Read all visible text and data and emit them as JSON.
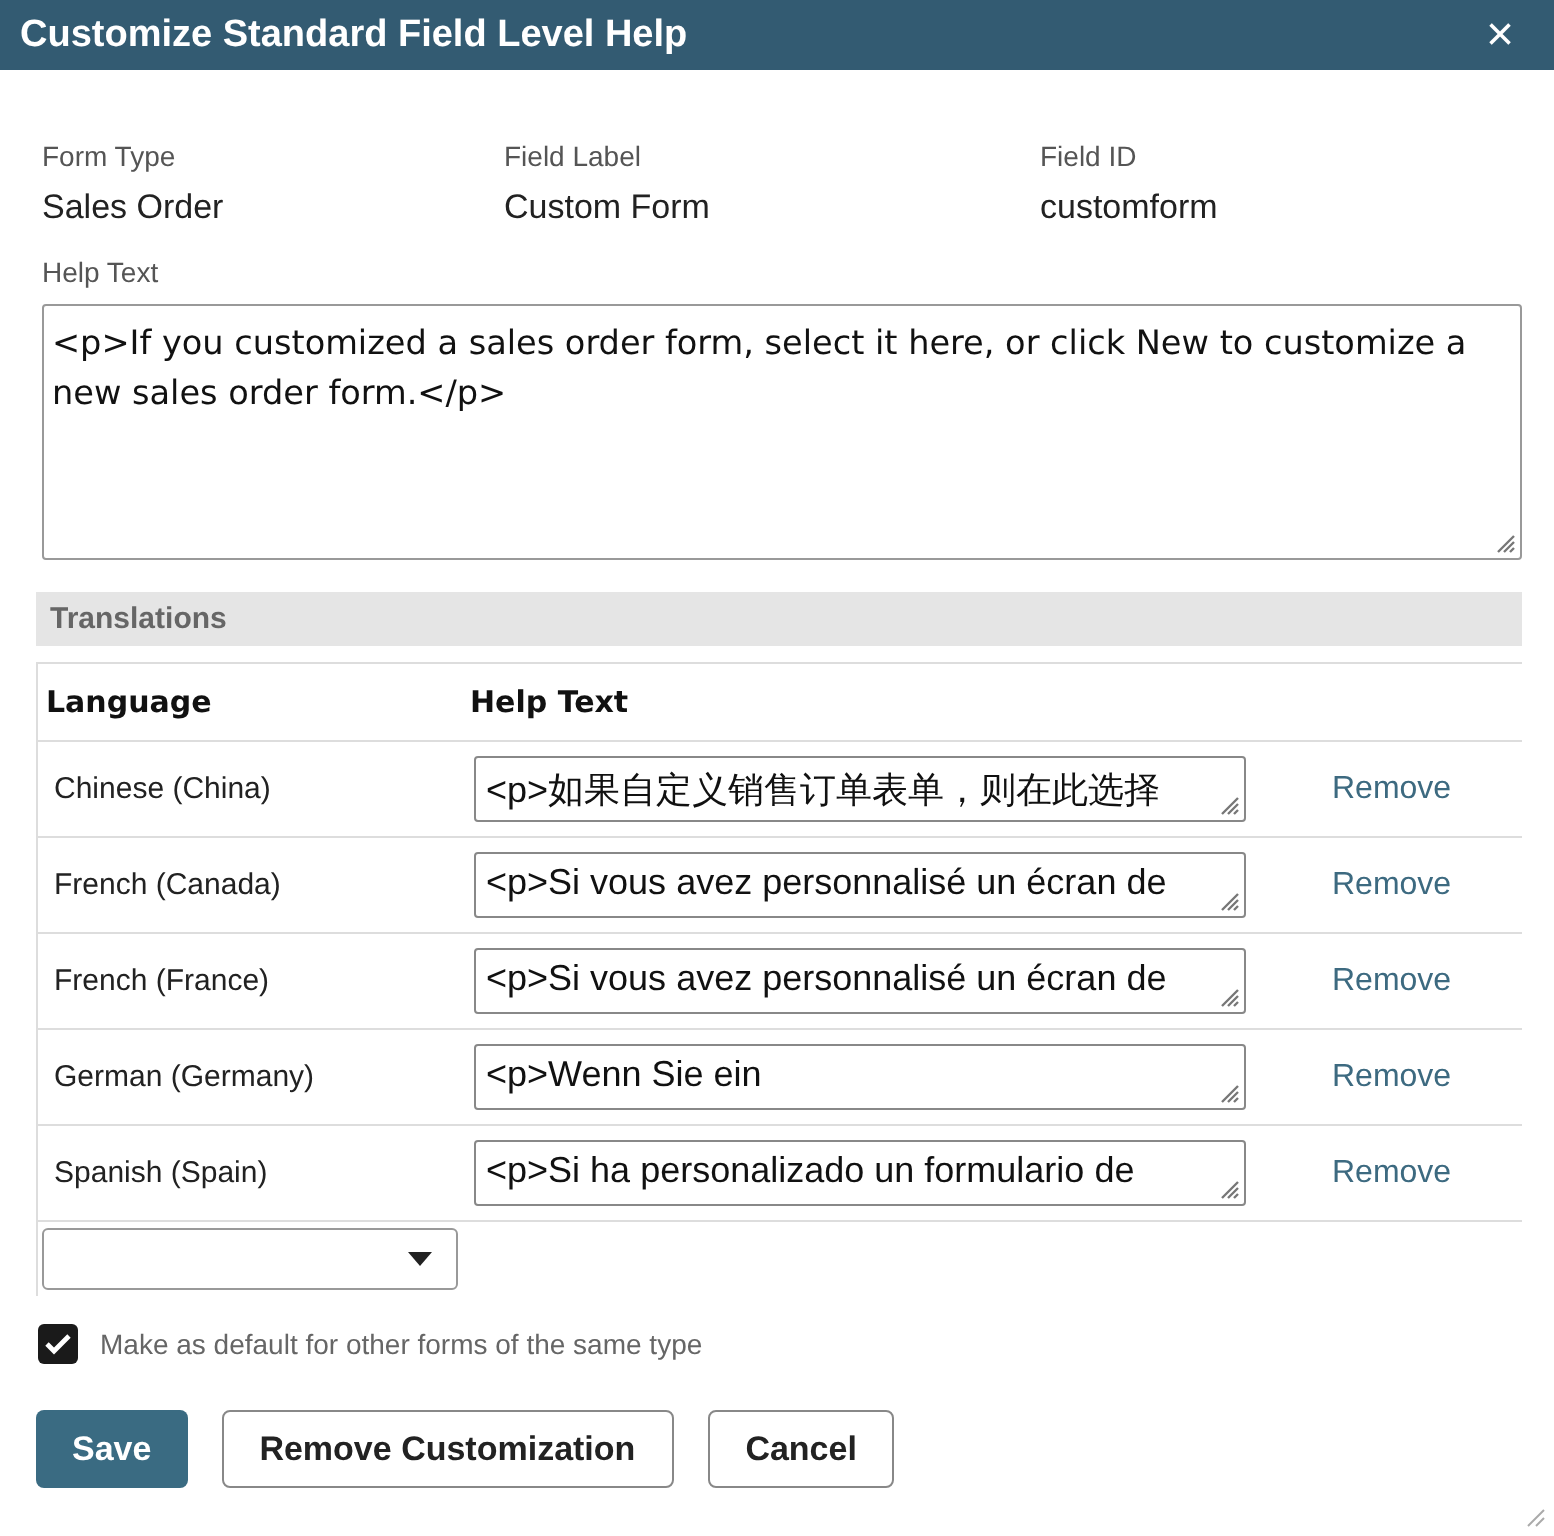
{
  "window": {
    "title": "Customize Standard Field Level Help",
    "close": "×"
  },
  "fields": [
    {
      "label": "Form Type",
      "value": "Sales Order"
    },
    {
      "label": "Field Label",
      "value": "Custom Form"
    },
    {
      "label": "Field ID",
      "value": "customform"
    }
  ],
  "help_text": {
    "label": "Help Text",
    "value": "<p>If you customized a sales order form, select it here, or click New to customize a new sales order form.</p>"
  },
  "translations": {
    "title": "Translations",
    "columns": [
      "Language",
      "Help Text"
    ],
    "rows": [
      {
        "language": "Chinese (China)",
        "text": "<p>如果自定义销售订单表单，则在此选择",
        "action": "Remove"
      },
      {
        "language": "French (Canada)",
        "text": "<p>Si vous avez personnalisé un écran de",
        "action": "Remove"
      },
      {
        "language": "French (France)",
        "text": "<p>Si vous avez personnalisé un écran de",
        "action": "Remove"
      },
      {
        "language": "German (Germany)",
        "text": "<p>Wenn Sie ein",
        "action": "Remove"
      },
      {
        "language": "Spanish (Spain)",
        "text": "<p>Si ha personalizado un formulario de",
        "action": "Remove"
      }
    ]
  },
  "default_checkbox": {
    "label": "Make as default for other forms of the same type",
    "checked": true
  },
  "buttons": [
    {
      "label": "Save",
      "kind": "primary"
    },
    {
      "label": "Remove Customization",
      "kind": "secondary"
    },
    {
      "label": "Cancel",
      "kind": "secondary"
    }
  ]
}
